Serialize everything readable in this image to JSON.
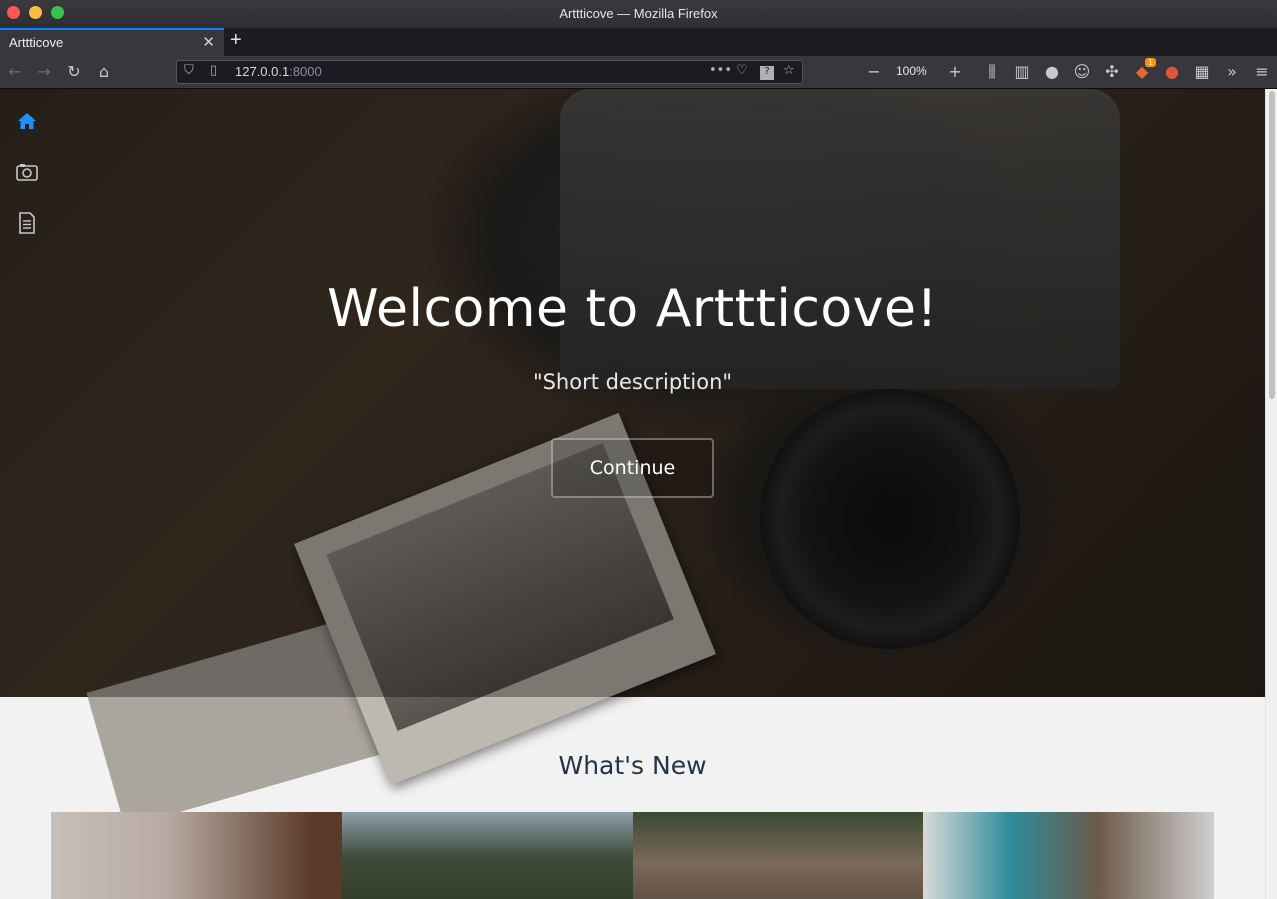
{
  "window": {
    "title": "Arttticove — Mozilla Firefox"
  },
  "tabs": [
    {
      "label": "Arttticove"
    }
  ],
  "toolbar": {
    "url_host": "127.0.0.1",
    "url_port": ":8000",
    "zoom": "100%",
    "notification_count": "1"
  },
  "sidenav": {
    "items": [
      {
        "name": "home",
        "icon": "home-icon",
        "active": true
      },
      {
        "name": "gallery",
        "icon": "camera-icon",
        "active": false
      },
      {
        "name": "documents",
        "icon": "document-icon",
        "active": false
      }
    ]
  },
  "hero": {
    "title": "Welcome to Arttticove!",
    "subtitle": "\"Short description\"",
    "button_label": "Continue"
  },
  "whats_new": {
    "title": "What's New"
  },
  "colors": {
    "accent": "#1e90ff",
    "heading": "#243447"
  }
}
